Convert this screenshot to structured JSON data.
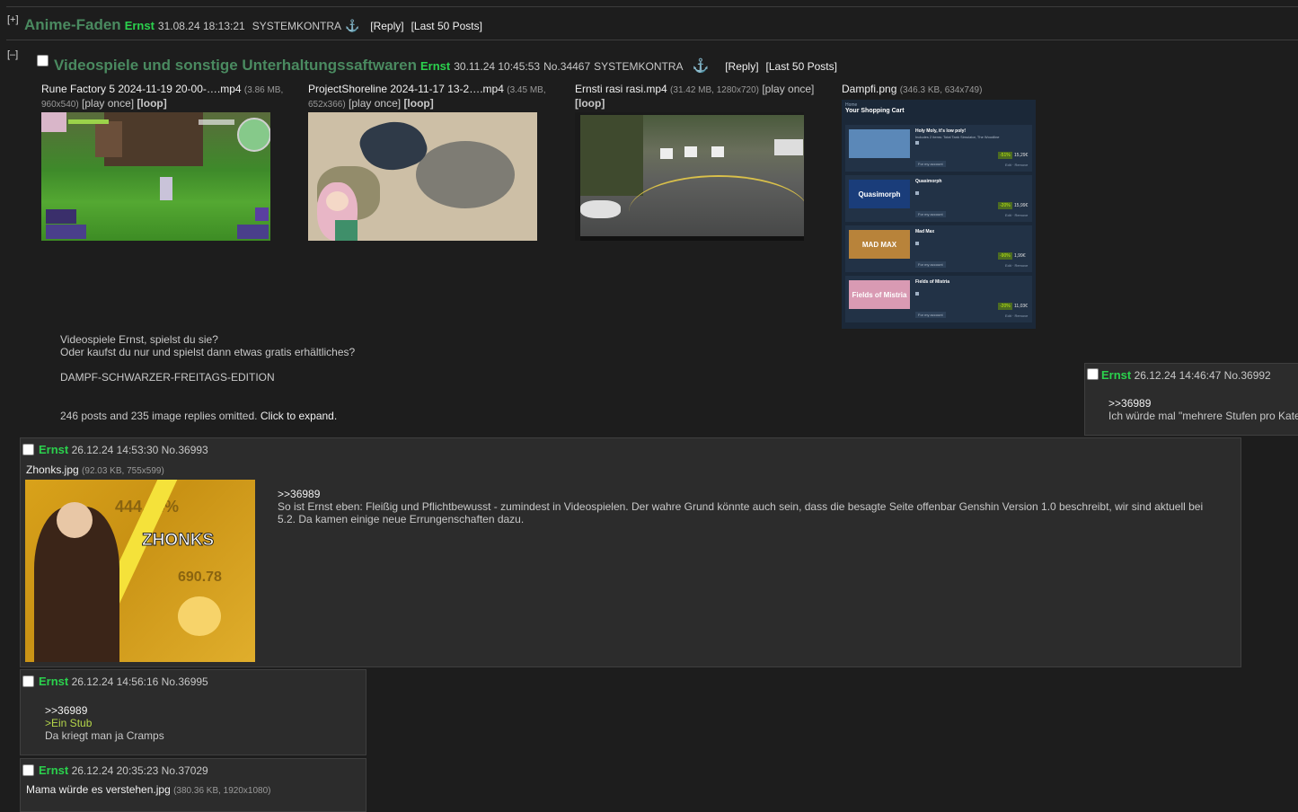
{
  "thread1": {
    "toggle": "[+]",
    "title": "Anime-Faden",
    "name": "Ernst",
    "date": "31.08.24 18:13:21",
    "poster_id": "SYSTEMKONTRA",
    "reply": "[Reply]",
    "last50": "[Last 50 Posts]"
  },
  "thread2": {
    "toggle": "[–]",
    "title": "Videospiele und sonstige Unterhaltungssaftwaren",
    "name": "Ernst",
    "date": "30.11.24 10:45:53",
    "no": "No.34467",
    "poster_id": "SYSTEMKONTRA",
    "reply": "[Reply]",
    "last50": "[Last 50 Posts]",
    "files": [
      {
        "name": "Rune Factory 5 2024-11-19 20-00-….mp4",
        "size": "(3.86 MB,",
        "dims": "960x540)",
        "play_once": "[play once]",
        "loop": "[loop]"
      },
      {
        "name": "ProjectShoreline 2024-11-17 13-2….mp4",
        "size": "(3.45 MB,",
        "dims": "652x366)",
        "play_once": "[play once]",
        "loop": "[loop]"
      },
      {
        "name": "Ernsti rasi rasi.mp4",
        "size": "(31.42 MB, 1280x720)",
        "play_once": "[play once]",
        "loop": "[loop]"
      },
      {
        "name": "Dampfi.png",
        "size": "(346.3 KB, 634x749)"
      }
    ],
    "cart": {
      "title": "Your Shopping Cart",
      "items": [
        {
          "name": "Holy Moly, it's low poly!",
          "sub": "Includes 2 items: Total Tank Simulator, The Woodline",
          "discount": "-51%",
          "price": "15,29€",
          "thumb_text": ""
        },
        {
          "name": "Quasimorph",
          "sub": "",
          "discount": "-20%",
          "price": "15,99€",
          "thumb_text": "Quasimorph"
        },
        {
          "name": "Mad Max",
          "sub": "",
          "discount": "-90%",
          "price": "1,99€",
          "thumb_text": "MAD MAX"
        },
        {
          "name": "Fields of Mistria",
          "sub": "",
          "discount": "-20%",
          "price": "11,03€",
          "thumb_text": "Fields of Mistria"
        }
      ],
      "for_account": "For my account",
      "remove": "Edit · Remove"
    },
    "op_line1": "Videospiele Ernst, spielst du sie?",
    "op_line2": "Oder kaufst du nur und spielst dann etwas gratis erhältliches?",
    "op_line3": "DAMPF-SCHWARZER-FREITAGS-EDITION",
    "omitted": "246 posts and 235 image replies omitted.",
    "expand": "Click to expand."
  },
  "reply_36992": {
    "name": "Ernst",
    "meta": "26.12.24 14:46:47 No.36992",
    "quote": ">>36989",
    "text": "Ich würde mal \"mehrere Stufen pro Kate"
  },
  "reply_36993": {
    "name": "Ernst",
    "meta": "26.12.24 14:53:30 No.36993",
    "file_name": "Zhonks.jpg",
    "file_info": "(92.03 KB, 755x599)",
    "img_text": "ZHONKS",
    "quote": ">>36989",
    "text": "So ist Ernst eben: Fleißig und Pflichtbewusst - zumindest in Videospielen. Der wahre Grund könnte auch sein, dass die besagte Seite offenbar Genshin Version 1.0 beschreibt, wir sind aktuell bei 5.2. Da kamen einige neue Errungenschaften dazu."
  },
  "reply_36995": {
    "name": "Ernst",
    "meta": "26.12.24 14:56:16 No.36995",
    "quote": ">>36989",
    "green": ">Ein Stub",
    "text": "Da kriegt man ja Cramps"
  },
  "reply_37029": {
    "name": "Ernst",
    "meta": "26.12.24 20:35:23 No.37029",
    "file_name": "Mama würde es verstehen.jpg",
    "file_info": "(380.36 KB, 1920x1080)"
  }
}
